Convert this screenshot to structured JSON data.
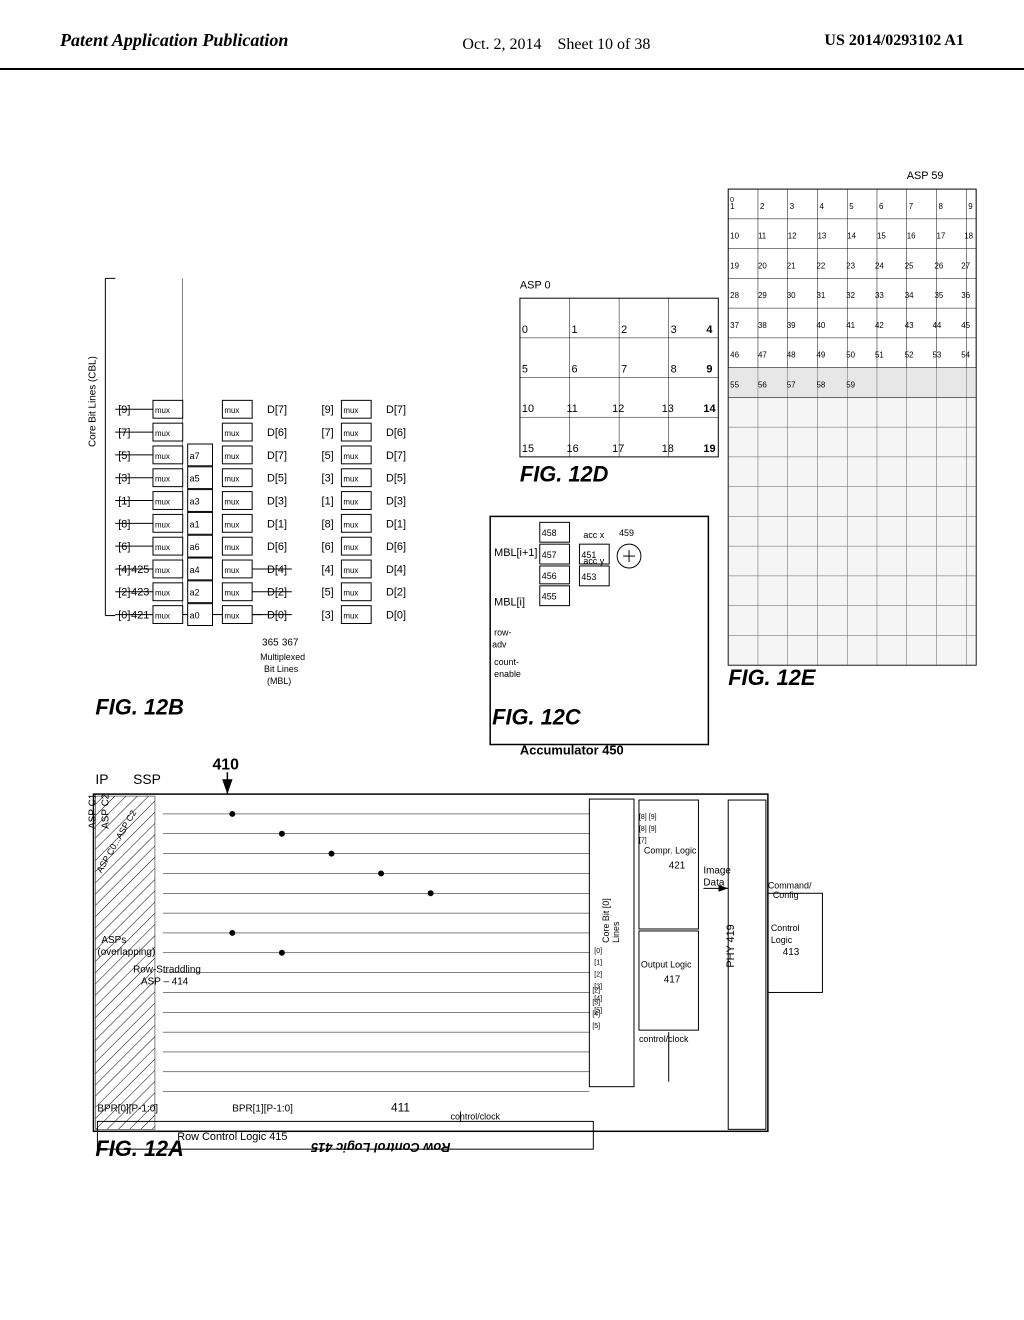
{
  "header": {
    "left_label": "Patent Application Publication",
    "center_date": "Oct. 2, 2014",
    "center_sheet": "Sheet 10 of 38",
    "right_patent": "US 2014/0293102 A1"
  },
  "figures": {
    "fig12a_label": "FIG. 12A",
    "fig12b_label": "FIG. 12B",
    "fig12c_label": "FIG. 12C",
    "fig12d_label": "FIG. 12D",
    "fig12e_label": "FIG. 12E"
  }
}
